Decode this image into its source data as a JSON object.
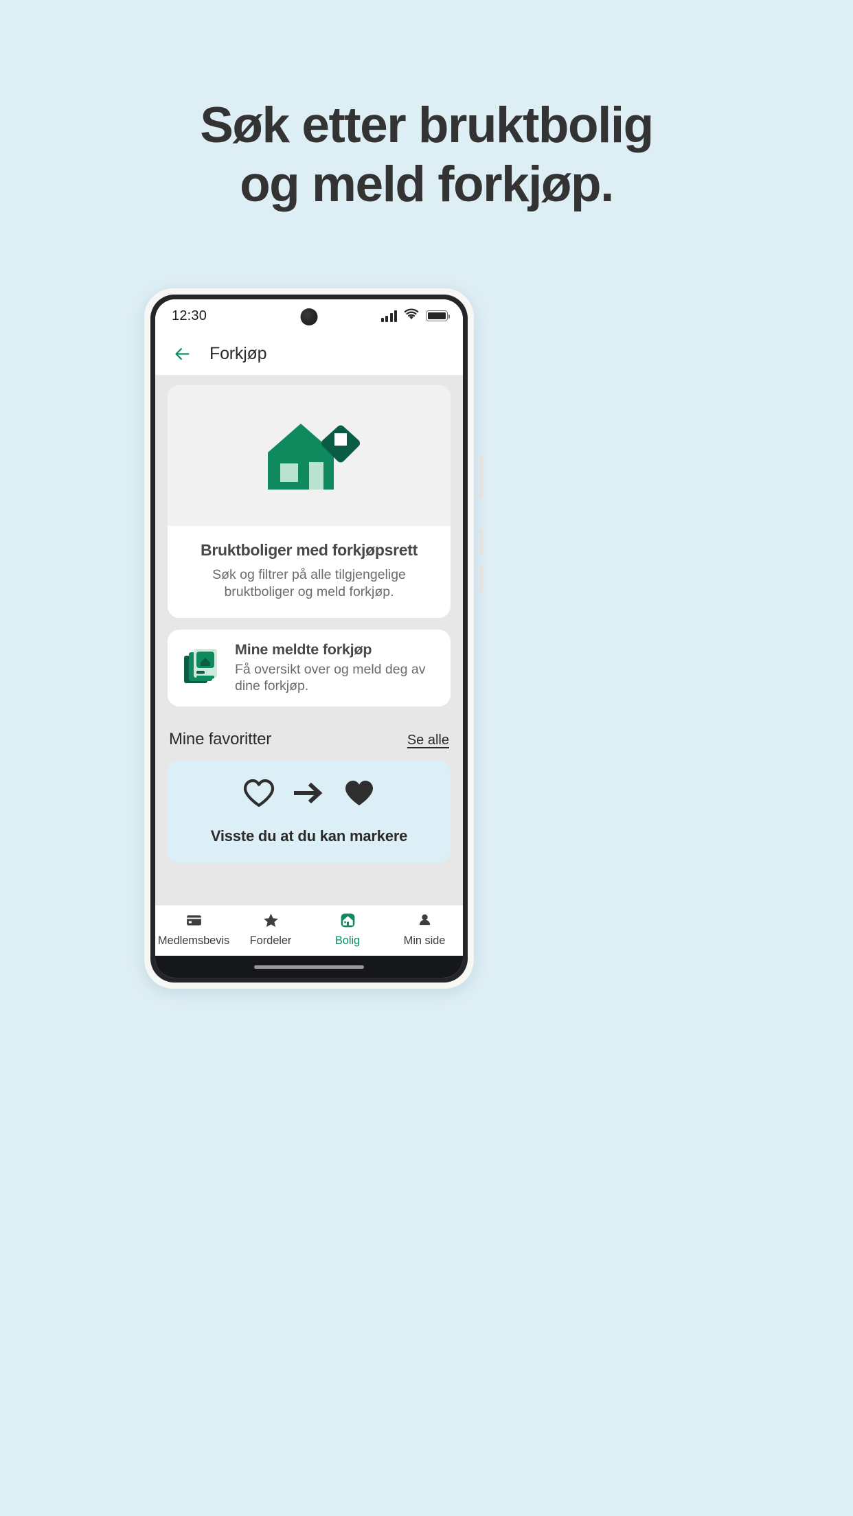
{
  "promo": {
    "headline_line1": "Søk etter bruktbolig",
    "headline_line2": "og meld forkjøp.",
    "background_color": "#deeef5",
    "text_color": "#333333"
  },
  "phone": {
    "status_bar": {
      "time": "12:30",
      "signal_icon": "signal-bars-icon",
      "wifi_icon": "wifi-icon",
      "battery_icon": "battery-full-icon",
      "camera_icon": "front-camera-punch-hole"
    },
    "header": {
      "back_icon": "back-arrow-icon",
      "title": "Forkjøp",
      "accent_color": "#0f8a5f"
    },
    "hero_card": {
      "illustration_icon": "house-with-tag-icon",
      "title": "Bruktboliger med forkjøpsrett",
      "description": "Søk og filtrer på alle tilgjengelige bruktboliger og meld forkjøp."
    },
    "list_card": {
      "icon": "documents-stack-icon",
      "title": "Mine meldte forkjøp",
      "description": "Få oversikt over og meld deg av dine forkjøp."
    },
    "favorites_section": {
      "title": "Mine favoritter",
      "link_label": "Se alle"
    },
    "tip_card": {
      "icon_outline_heart": "heart-outline-icon",
      "icon_arrow": "arrow-right-icon",
      "icon_filled_heart": "heart-filled-icon",
      "text": "Visste du at du kan markere",
      "background_color": "#dceef6"
    },
    "bottom_nav": {
      "items": [
        {
          "label": "Medlemsbevis",
          "icon": "membership-card-icon",
          "active": false
        },
        {
          "label": "Fordeler",
          "icon": "star-icon",
          "active": false
        },
        {
          "label": "Bolig",
          "icon": "home-icon",
          "active": true
        },
        {
          "label": "Min side",
          "icon": "person-icon",
          "active": false
        }
      ]
    },
    "home_indicator": "home-indicator-bar"
  },
  "colors": {
    "green": "#0f8a5f",
    "green_dark": "#0a5c45",
    "green_light": "#b9e3d0",
    "dark": "#2b2b2b"
  }
}
